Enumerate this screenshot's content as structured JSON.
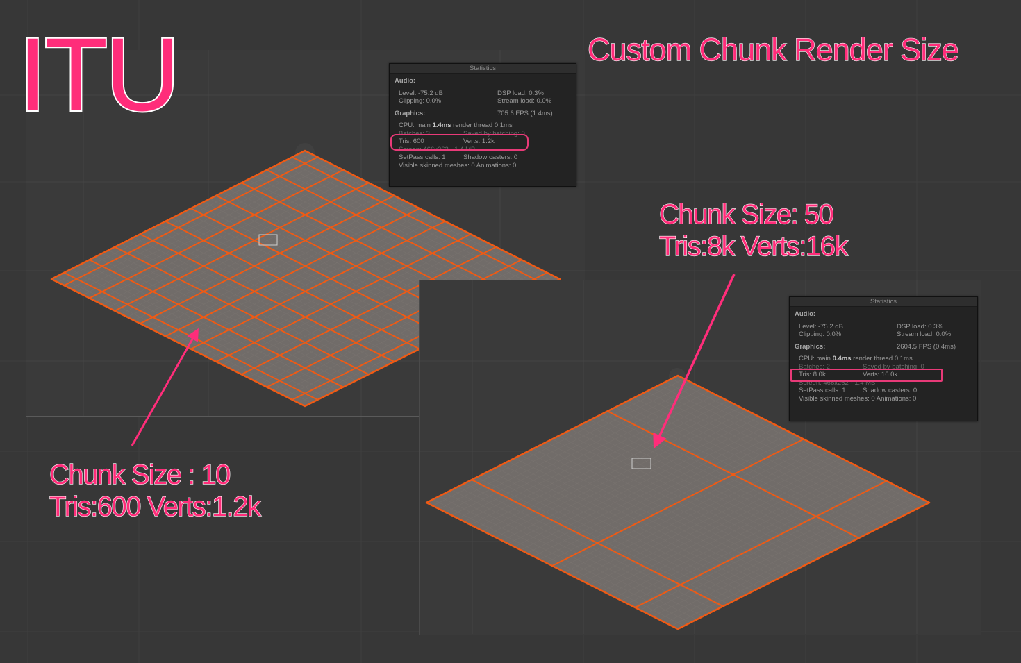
{
  "colors": {
    "accent": "#ff2d7a",
    "mesh_edge": "#f05a14",
    "mesh_fill": "#716c69",
    "viewport_bg": "#3a3a3a"
  },
  "logo": "ITU",
  "title": "Custom Chunk Render Size",
  "annotations": {
    "right": {
      "line1": "Chunk Size: 50",
      "line2": "Tris:8k Verts:16k",
      "chunk_grid": [
        3,
        2
      ]
    },
    "left": {
      "line1": "Chunk Size : 10",
      "line2": "Tris:600 Verts:1.2k",
      "chunk_grid": [
        10,
        10
      ]
    }
  },
  "stats_left": {
    "header": "Statistics",
    "audio_label": "Audio:",
    "level": "Level: -75.2 dB",
    "dsp": "DSP load: 0.3%",
    "clipping": "Clipping: 0.0%",
    "stream": "Stream load: 0.0%",
    "graphics_label": "Graphics:",
    "fps": "705.6 FPS (1.4ms)",
    "cpu_pre": "CPU: main ",
    "cpu_val": "1.4ms",
    "cpu_post": "  render thread 0.1ms",
    "batches": "Batches: 3",
    "saved": "Saved by batching: 0",
    "tris": "Tris: 600",
    "verts": "Verts: 1.2k",
    "screen": "Screen: 466x262 - 1.4 MB",
    "setpass": "SetPass calls: 1",
    "shadow": "Shadow casters: 0",
    "skinned": "Visible skinned meshes: 0  Animations: 0"
  },
  "stats_right": {
    "header": "Statistics",
    "audio_label": "Audio:",
    "level": "Level: -75.2 dB",
    "dsp": "DSP load: 0.3%",
    "clipping": "Clipping: 0.0%",
    "stream": "Stream load: 0.0%",
    "graphics_label": "Graphics:",
    "fps": "2604.5 FPS (0.4ms)",
    "cpu_pre": "CPU: main ",
    "cpu_val": "0.4ms",
    "cpu_post": "  render thread 0.1ms",
    "batches": "Batches: 2",
    "saved": "Saved by batching: 0",
    "tris": "Tris: 8.0k",
    "verts": "Verts: 16.0k",
    "screen": "Screen: 466x262 - 1.4 MB",
    "setpass": "SetPass calls: 1",
    "shadow": "Shadow casters: 0",
    "skinned": "Visible skinned meshes: 0  Animations: 0"
  }
}
